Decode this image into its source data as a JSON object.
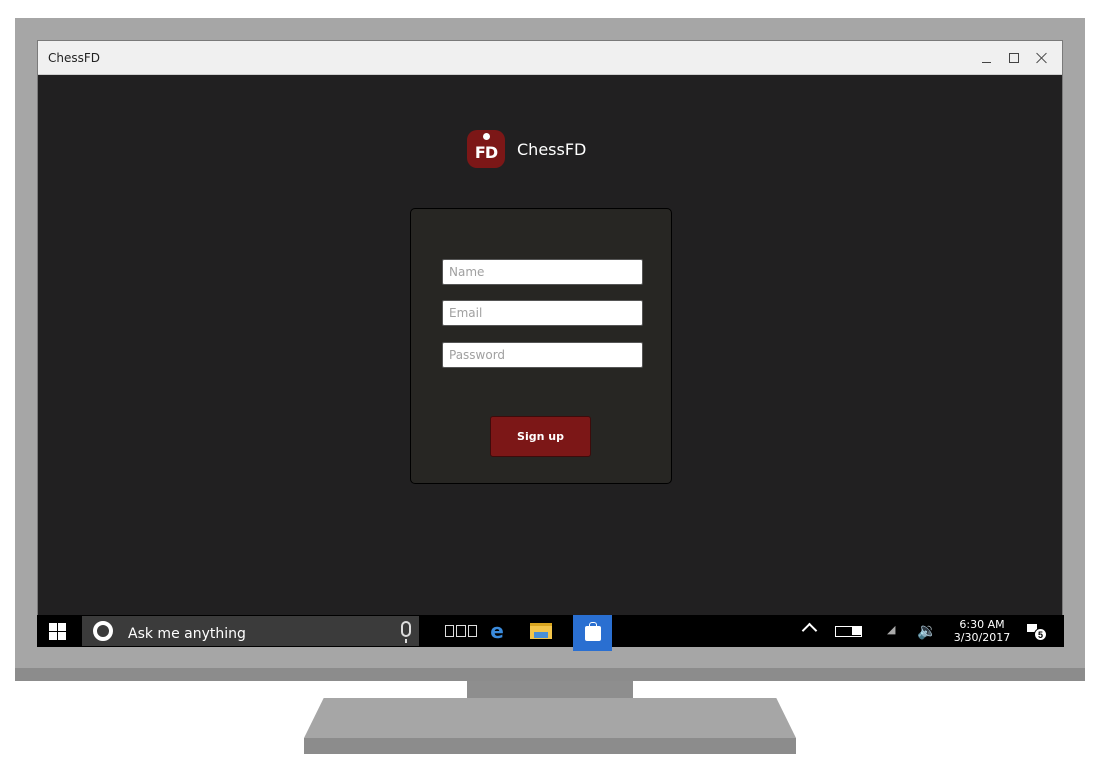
{
  "window": {
    "title": "ChessFD"
  },
  "brand": {
    "logo_text": "FD",
    "name": "ChessFD",
    "accent_color": "#7c1717"
  },
  "form": {
    "name_placeholder": "Name",
    "email_placeholder": "Email",
    "password_placeholder": "Password",
    "signup_label": "Sign up"
  },
  "taskbar": {
    "search_text": "Ask me anything",
    "edge_glyph": "e",
    "clock_time": "6:30 AM",
    "clock_date": "3/30/2017",
    "notification_count": "5",
    "icons": [
      "windows-start-icon",
      "cortana-icon",
      "microphone-icon",
      "task-view-icon",
      "edge-icon",
      "file-explorer-icon",
      "store-icon",
      "chevron-up-icon",
      "battery-icon",
      "wifi-icon",
      "volume-icon",
      "notification-icon"
    ]
  }
}
